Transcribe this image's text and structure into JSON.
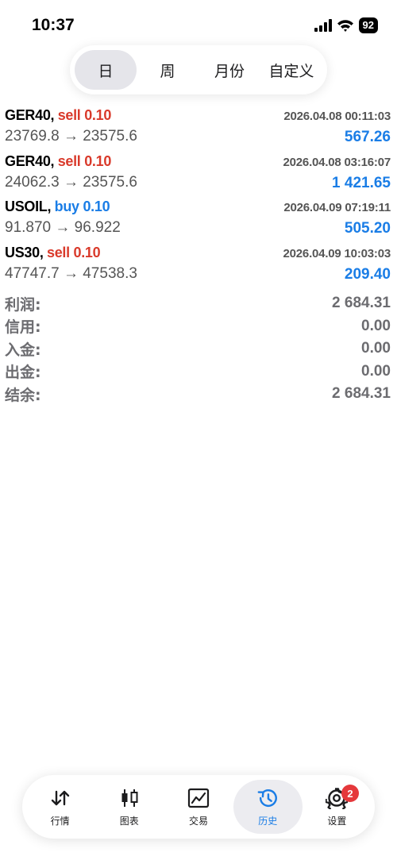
{
  "status_bar": {
    "time": "10:37",
    "battery": "92"
  },
  "period_tabs": [
    {
      "label": "日",
      "active": true
    },
    {
      "label": "周",
      "active": false
    },
    {
      "label": "月份",
      "active": false
    },
    {
      "label": "自定义",
      "active": false
    }
  ],
  "trades": [
    {
      "symbol": "GER40,",
      "side": "sell 0.10",
      "time": "2026.04.08 00:11:03",
      "prices": "23769.8 → 23575.6",
      "profit": "567.26"
    },
    {
      "symbol": "GER40,",
      "side": "sell 0.10",
      "time": "2026.04.08 03:16:07",
      "prices": "24062.3 → 23575.6",
      "profit": "1 421.65"
    },
    {
      "symbol": "USOIL,",
      "side": "buy 0.10",
      "time": "2026.04.09 07:19:11",
      "prices": "91.870 → 96.922",
      "profit": "505.20"
    },
    {
      "symbol": "US30,",
      "side": "sell 0.10",
      "time": "2026.04.09 10:03:03",
      "prices": "47747.7 → 47538.3",
      "profit": "209.40"
    }
  ],
  "summary": [
    {
      "label": "利润:",
      "value": "2 684.31"
    },
    {
      "label": "信用:",
      "value": "0.00"
    },
    {
      "label": "入金:",
      "value": "0.00"
    },
    {
      "label": "出金:",
      "value": "0.00"
    },
    {
      "label": "结余:",
      "value": "2 684.31"
    }
  ],
  "tabbar": [
    {
      "label": "行情",
      "icon": "quotes-arrows-icon",
      "active": false
    },
    {
      "label": "图表",
      "icon": "candlestick-chart-icon",
      "active": false
    },
    {
      "label": "交易",
      "icon": "trade-chart-icon",
      "active": false
    },
    {
      "label": "历史",
      "icon": "history-clock-icon",
      "active": true
    },
    {
      "label": "设置",
      "icon": "gear-icon",
      "active": false,
      "badge": "2"
    }
  ],
  "colors": {
    "sell": "#d93a2b",
    "buy": "#1a7de6",
    "profit": "#1a7de6",
    "badge": "#e5383b"
  }
}
